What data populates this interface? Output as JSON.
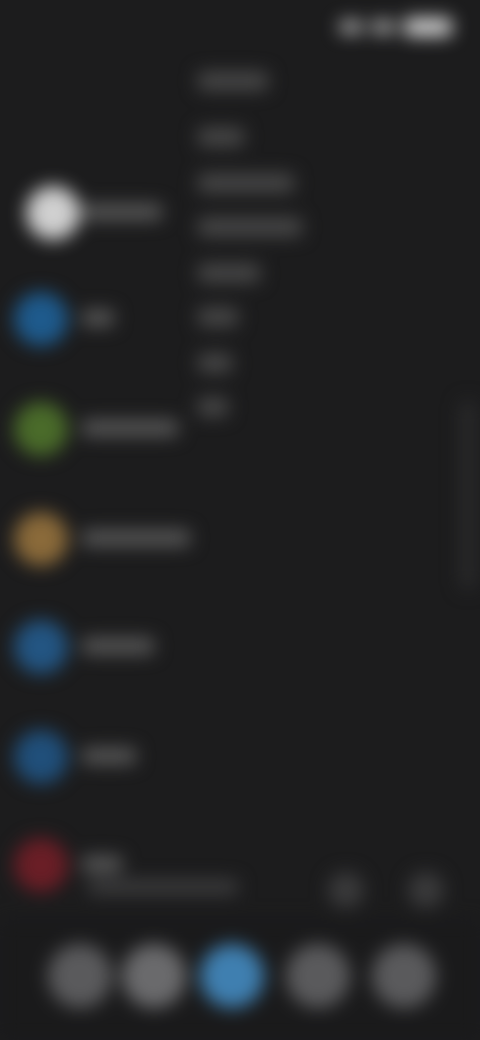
{
  "colors": {
    "background": "#1c1c1d",
    "app_white": "#d0d0d0",
    "app_blue": "#1e5a8c",
    "app_green": "#4a6b2a",
    "app_orange": "#8a6a3a",
    "app_blue_2": "#235582",
    "app_blue_3": "#204f7a",
    "app_red": "#6a1e26",
    "dock_active": "#3f7fb0"
  },
  "status_bar": {
    "icons": [
      "signal-icon",
      "wifi-icon",
      "battery-icon"
    ]
  },
  "menu_items": [
    {
      "icon": "text-line",
      "index": 0
    },
    {
      "icon": "text-line",
      "index": 1
    },
    {
      "icon": "text-line",
      "index": 2
    },
    {
      "icon": "text-line",
      "index": 3
    },
    {
      "icon": "text-line",
      "index": 4
    },
    {
      "icon": "text-line",
      "index": 5
    },
    {
      "icon": "text-line",
      "index": 6
    },
    {
      "icon": "text-line",
      "index": 7
    }
  ],
  "apps": [
    {
      "icon": "app-icon-white",
      "color_key": "app_white"
    },
    {
      "icon": "app-icon-blue",
      "color_key": "app_blue"
    },
    {
      "icon": "app-icon-green",
      "color_key": "app_green"
    },
    {
      "icon": "app-icon-orange",
      "color_key": "app_orange"
    },
    {
      "icon": "app-icon-blue",
      "color_key": "app_blue_2"
    },
    {
      "icon": "app-icon-blue",
      "color_key": "app_blue_3"
    },
    {
      "icon": "app-icon-red",
      "color_key": "app_red"
    }
  ],
  "dock": {
    "buttons": [
      "dock-button",
      "dock-button",
      "dock-button-active",
      "dock-button",
      "dock-button"
    ]
  }
}
